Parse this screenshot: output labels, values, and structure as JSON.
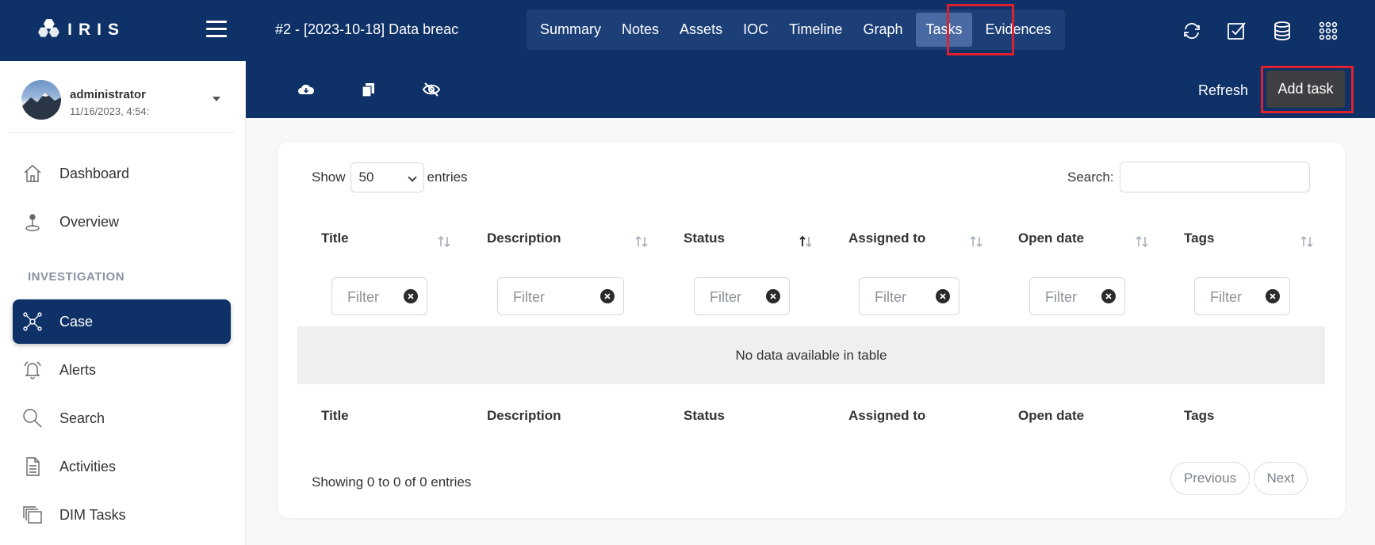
{
  "app": {
    "logo_text": "IRIS"
  },
  "header": {
    "case_title": "#2 - [2023-10-18] Data breac",
    "tabs": [
      "Summary",
      "Notes",
      "Assets",
      "IOC",
      "Timeline",
      "Graph",
      "Tasks",
      "Evidences"
    ],
    "active_tab": "Tasks",
    "right_icons": [
      "sync-icon",
      "checkbox-icon",
      "database-icon",
      "apps-grid-icon"
    ]
  },
  "user": {
    "name": "administrator",
    "date": "11/16/2023, 4:54:"
  },
  "sidebar": {
    "section_label": "INVESTIGATION",
    "items": [
      {
        "label": "Dashboard",
        "icon": "home-icon"
      },
      {
        "label": "Overview",
        "icon": "pin-icon"
      },
      {
        "label": "Case",
        "icon": "network-icon",
        "active": true
      },
      {
        "label": "Alerts",
        "icon": "bell-icon"
      },
      {
        "label": "Search",
        "icon": "search-icon"
      },
      {
        "label": "Activities",
        "icon": "clipboard-icon"
      },
      {
        "label": "DIM Tasks",
        "icon": "stack-icon"
      }
    ]
  },
  "toolbar": {
    "icons": [
      "cloud-download-icon",
      "copy-icon",
      "eye-off-icon"
    ],
    "refresh_label": "Refresh",
    "add_task_label": "Add task"
  },
  "table": {
    "show_label": "Show",
    "entries_value": "50",
    "entries_label": "entries",
    "search_label": "Search:",
    "columns": [
      "Title",
      "Description",
      "Status",
      "Assigned to",
      "Open date",
      "Tags"
    ],
    "filter_placeholder": "Filter",
    "empty_message": "No data available in table",
    "info": "Showing 0 to 0 of 0 entries",
    "prev_label": "Previous",
    "next_label": "Next"
  },
  "colors": {
    "navy": "#0e3167",
    "highlight": "#e0202e",
    "button_dark": "#3d3f43"
  }
}
